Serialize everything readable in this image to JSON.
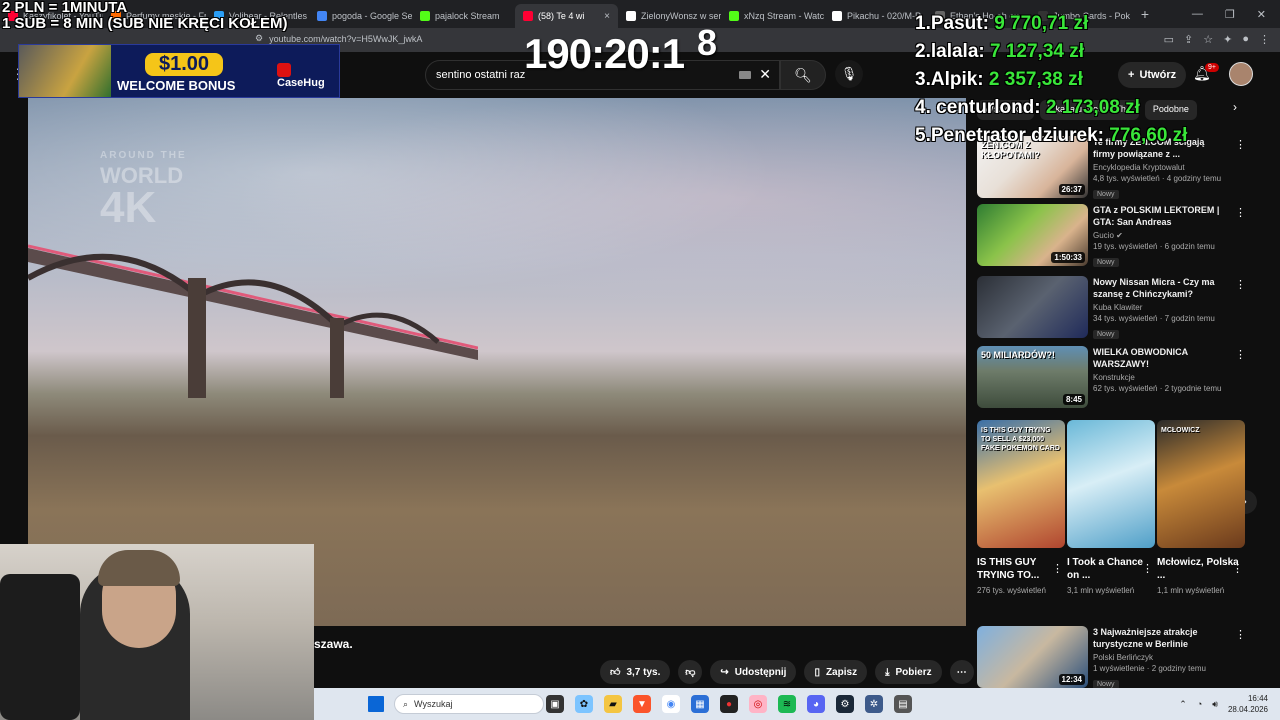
{
  "browser": {
    "tabs": [
      {
        "label": "Kaszyfikolet - YouTube",
        "color": "#ff0033"
      },
      {
        "label": "Perfumy meskie - Fr",
        "color": "#ff6a00"
      },
      {
        "label": "Volibear - Relentles",
        "color": "#2a9df4"
      },
      {
        "label": "pogoda - Google Se",
        "color": "#4285f4"
      },
      {
        "label": "pajalock Stream",
        "color": "#53fc18"
      },
      {
        "label": "(58) Te 4 wi",
        "color": "#ff0033",
        "active": true
      },
      {
        "label": "ZielonyWonsz w ser",
        "color": "#ffffff"
      },
      {
        "label": "xNzq Stream - Watc",
        "color": "#53fc18"
      },
      {
        "label": "Pikachu - 020/M-P",
        "color": "#ffffff"
      },
      {
        "label": "Ethan's Ho-oh ex",
        "color": "#666666"
      },
      {
        "label": "Jumbo Cards - Pok",
        "color": "#333333"
      }
    ],
    "url": "youtube.com/watch?v=H5WwJK_jwkA",
    "new_tab": "+",
    "close": "×"
  },
  "overlay": {
    "line1": "2 PLN = 1MINUTA",
    "line2": "1 SUB = 8 MIN (SUB NIE KRĘCI KOŁEM)",
    "timer": "190:20:1",
    "timer_sup": "8",
    "leaderboard": [
      {
        "name": "1.Pasut: ",
        "amount": "9 770,71 zł"
      },
      {
        "name": "2.lalala: ",
        "amount": "7 127,34 zł"
      },
      {
        "name": "3.Alpik: ",
        "amount": "2 357,38 zł"
      },
      {
        "name": "4. centurlond: ",
        "amount": "2 173,08 zł"
      },
      {
        "name": "5.Penetrator dziurek: ",
        "amount": "776,60 zł"
      }
    ],
    "ad": {
      "price": "$1.00",
      "bonus": "WELCOME BONUS",
      "brand": "CaseHug"
    }
  },
  "youtube": {
    "search_value": "sentino ostatni raz",
    "create_label": "Utwórz",
    "notif_count": "9+",
    "watermark": {
      "line1": "AROUND THE",
      "line2": "WORLD",
      "line3": "4K"
    },
    "caption": "szawa.",
    "actions": {
      "likes": "3,7 tys.",
      "share": "Udostępnij",
      "save": "Zapisz",
      "download": "Pobierz"
    },
    "chips": [
      "Wszystkie",
      "Z kanału Around The",
      "Podobne"
    ],
    "videos": [
      {
        "title": "Te firmy ZEN.COM ścigają firmy powiązane z ...",
        "channel": "Encyklopedia Kryptowalut",
        "meta": "4,8 tys. wyświetleń · 4 godziny temu",
        "badge": "Nowy",
        "duration": "26:37",
        "thumb_text": "ZEN.COM Z KŁOPOTAMI?"
      },
      {
        "title": "GTA z POLSKIM LEKTOREM | GTA: San Andreas",
        "channel": "Gucio ✔",
        "meta": "19 tys. wyświetleń · 6 godzin temu",
        "badge": "Nowy",
        "duration": "1:50:33",
        "thumb_text": ""
      },
      {
        "title": "Nowy Nissan Micra - Czy ma szansę z Chińczykami?",
        "channel": "Kuba Klawiter",
        "meta": "34 tys. wyświetleń · 7 godzin temu",
        "badge": "Nowy",
        "duration": "",
        "thumb_text": ""
      },
      {
        "title": "WIELKA OBWODNICA WARSZAWY!",
        "channel": "Konstrukcje",
        "meta": "62 tys. wyświetleń · 2 tygodnie temu",
        "badge": "",
        "duration": "8:45",
        "thumb_text": "50 MILIARDÓW?!"
      },
      {
        "title": "3 Najważniejsze atrakcje turystyczne w Berlinie",
        "channel": "Polski Berlińczyk",
        "meta": "1 wyświetlenie · 2 godziny temu",
        "badge": "Nowy",
        "duration": "12:34",
        "thumb_text": ""
      }
    ],
    "shorts": [
      {
        "title": "IS THIS GUY TRYING TO...",
        "views": "276 tys. wyświetleń",
        "thumb_text": "IS THIS GUY TRYING TO SELL A $23,000 FAKE POKEMON CARD"
      },
      {
        "title": "I Took a Chance on ...",
        "views": "3,1 mln wyświetleń",
        "thumb_text": ""
      },
      {
        "title": "Mcłowicz, Polska ...",
        "views": "1,1 mln wyświetleń",
        "thumb_text": "MCŁOWICZ"
      }
    ]
  },
  "taskbar": {
    "search_placeholder": "Wyszukaj",
    "time": "16:44",
    "date": "28.04.2026"
  }
}
